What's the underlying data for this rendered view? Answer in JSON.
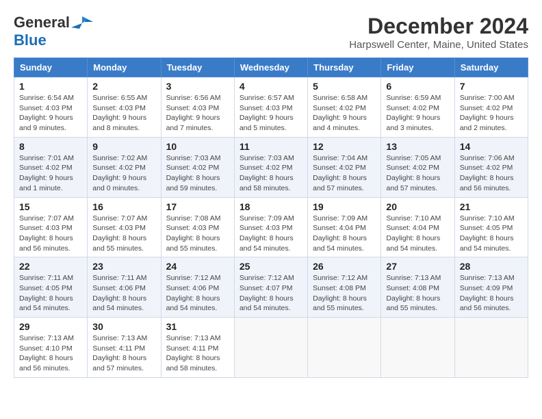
{
  "header": {
    "logo_general": "General",
    "logo_blue": "Blue",
    "month_title": "December 2024",
    "subtitle": "Harpswell Center, Maine, United States"
  },
  "weekdays": [
    "Sunday",
    "Monday",
    "Tuesday",
    "Wednesday",
    "Thursday",
    "Friday",
    "Saturday"
  ],
  "weeks": [
    [
      {
        "day": "1",
        "sunrise": "6:54 AM",
        "sunset": "4:03 PM",
        "daylight": "9 hours and 9 minutes."
      },
      {
        "day": "2",
        "sunrise": "6:55 AM",
        "sunset": "4:03 PM",
        "daylight": "9 hours and 8 minutes."
      },
      {
        "day": "3",
        "sunrise": "6:56 AM",
        "sunset": "4:03 PM",
        "daylight": "9 hours and 7 minutes."
      },
      {
        "day": "4",
        "sunrise": "6:57 AM",
        "sunset": "4:03 PM",
        "daylight": "9 hours and 5 minutes."
      },
      {
        "day": "5",
        "sunrise": "6:58 AM",
        "sunset": "4:02 PM",
        "daylight": "9 hours and 4 minutes."
      },
      {
        "day": "6",
        "sunrise": "6:59 AM",
        "sunset": "4:02 PM",
        "daylight": "9 hours and 3 minutes."
      },
      {
        "day": "7",
        "sunrise": "7:00 AM",
        "sunset": "4:02 PM",
        "daylight": "9 hours and 2 minutes."
      }
    ],
    [
      {
        "day": "8",
        "sunrise": "7:01 AM",
        "sunset": "4:02 PM",
        "daylight": "9 hours and 1 minute."
      },
      {
        "day": "9",
        "sunrise": "7:02 AM",
        "sunset": "4:02 PM",
        "daylight": "9 hours and 0 minutes."
      },
      {
        "day": "10",
        "sunrise": "7:03 AM",
        "sunset": "4:02 PM",
        "daylight": "8 hours and 59 minutes."
      },
      {
        "day": "11",
        "sunrise": "7:03 AM",
        "sunset": "4:02 PM",
        "daylight": "8 hours and 58 minutes."
      },
      {
        "day": "12",
        "sunrise": "7:04 AM",
        "sunset": "4:02 PM",
        "daylight": "8 hours and 57 minutes."
      },
      {
        "day": "13",
        "sunrise": "7:05 AM",
        "sunset": "4:02 PM",
        "daylight": "8 hours and 57 minutes."
      },
      {
        "day": "14",
        "sunrise": "7:06 AM",
        "sunset": "4:02 PM",
        "daylight": "8 hours and 56 minutes."
      }
    ],
    [
      {
        "day": "15",
        "sunrise": "7:07 AM",
        "sunset": "4:03 PM",
        "daylight": "8 hours and 56 minutes."
      },
      {
        "day": "16",
        "sunrise": "7:07 AM",
        "sunset": "4:03 PM",
        "daylight": "8 hours and 55 minutes."
      },
      {
        "day": "17",
        "sunrise": "7:08 AM",
        "sunset": "4:03 PM",
        "daylight": "8 hours and 55 minutes."
      },
      {
        "day": "18",
        "sunrise": "7:09 AM",
        "sunset": "4:03 PM",
        "daylight": "8 hours and 54 minutes."
      },
      {
        "day": "19",
        "sunrise": "7:09 AM",
        "sunset": "4:04 PM",
        "daylight": "8 hours and 54 minutes."
      },
      {
        "day": "20",
        "sunrise": "7:10 AM",
        "sunset": "4:04 PM",
        "daylight": "8 hours and 54 minutes."
      },
      {
        "day": "21",
        "sunrise": "7:10 AM",
        "sunset": "4:05 PM",
        "daylight": "8 hours and 54 minutes."
      }
    ],
    [
      {
        "day": "22",
        "sunrise": "7:11 AM",
        "sunset": "4:05 PM",
        "daylight": "8 hours and 54 minutes."
      },
      {
        "day": "23",
        "sunrise": "7:11 AM",
        "sunset": "4:06 PM",
        "daylight": "8 hours and 54 minutes."
      },
      {
        "day": "24",
        "sunrise": "7:12 AM",
        "sunset": "4:06 PM",
        "daylight": "8 hours and 54 minutes."
      },
      {
        "day": "25",
        "sunrise": "7:12 AM",
        "sunset": "4:07 PM",
        "daylight": "8 hours and 54 minutes."
      },
      {
        "day": "26",
        "sunrise": "7:12 AM",
        "sunset": "4:08 PM",
        "daylight": "8 hours and 55 minutes."
      },
      {
        "day": "27",
        "sunrise": "7:13 AM",
        "sunset": "4:08 PM",
        "daylight": "8 hours and 55 minutes."
      },
      {
        "day": "28",
        "sunrise": "7:13 AM",
        "sunset": "4:09 PM",
        "daylight": "8 hours and 56 minutes."
      }
    ],
    [
      {
        "day": "29",
        "sunrise": "7:13 AM",
        "sunset": "4:10 PM",
        "daylight": "8 hours and 56 minutes."
      },
      {
        "day": "30",
        "sunrise": "7:13 AM",
        "sunset": "4:11 PM",
        "daylight": "8 hours and 57 minutes."
      },
      {
        "day": "31",
        "sunrise": "7:13 AM",
        "sunset": "4:11 PM",
        "daylight": "8 hours and 58 minutes."
      },
      null,
      null,
      null,
      null
    ]
  ]
}
